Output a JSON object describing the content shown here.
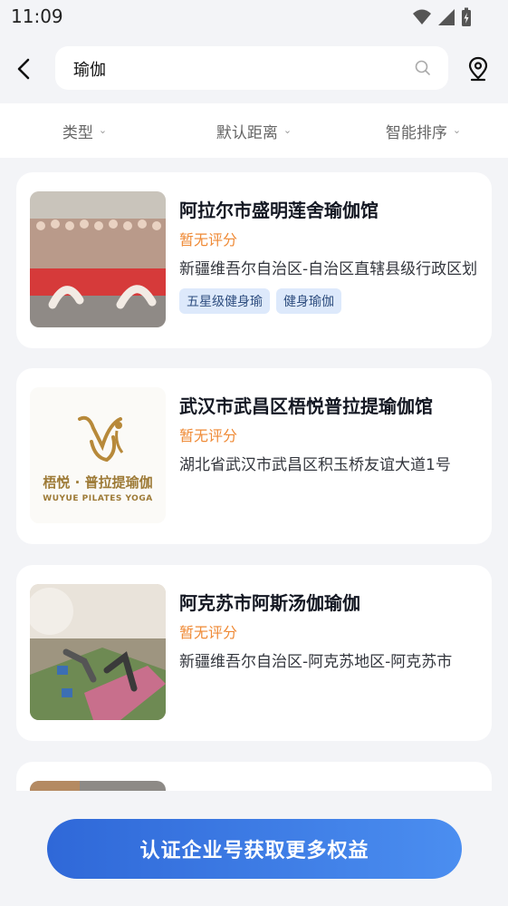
{
  "status_bar": {
    "time": "11:09"
  },
  "search": {
    "query": "瑜伽"
  },
  "filters": [
    {
      "label": "类型"
    },
    {
      "label": "默认距离"
    },
    {
      "label": "智能排序"
    }
  ],
  "results": [
    {
      "title": "阿拉尔市盛明莲舍瑜伽馆",
      "rating": "暂无评分",
      "address": "新疆维吾尔自治区-自治区直辖县级行政区划",
      "tags": [
        "五星级健身瑜",
        "健身瑜伽"
      ]
    },
    {
      "title": "武汉市武昌区梧悦普拉提瑜伽馆",
      "rating": "暂无评分",
      "address": "湖北省武汉市武昌区积玉桥友谊大道1号",
      "logo": {
        "cn": "梧悦 · 普拉提瑜伽",
        "en": "WUYUE PILATES YOGA"
      }
    },
    {
      "title": "阿克苏市阿斯汤伽瑜伽",
      "rating": "暂无评分",
      "address": "新疆维吾尔自治区-阿克苏地区-阿克苏市"
    }
  ],
  "bottom_button": {
    "label": "认证企业号获取更多权益"
  },
  "colors": {
    "accent": "#2f68d8",
    "rating": "#ef8a36",
    "tag_bg": "#dde9fb"
  }
}
